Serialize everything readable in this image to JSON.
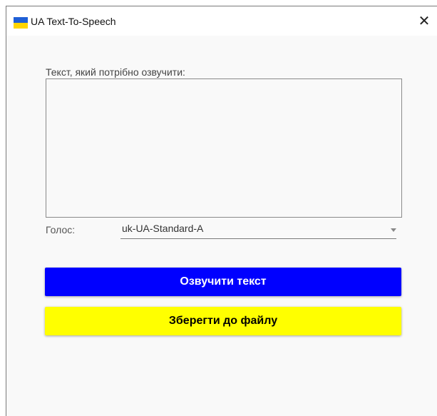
{
  "window": {
    "title": "UA Text-To-Speech",
    "close_label": "✕",
    "flag_colors": [
      "#1f5fd6",
      "#ffd500"
    ]
  },
  "form": {
    "text_label": "Текст, який потрібно озвучити:",
    "text_value": "",
    "voice_label": "Голос:",
    "voice_selected": "uk-UA-Standard-A"
  },
  "buttons": {
    "speak_label": "Озвучити текст",
    "speak_color": "#0000ff",
    "save_label": "Зберегти до файлу",
    "save_color": "#ffff00"
  }
}
